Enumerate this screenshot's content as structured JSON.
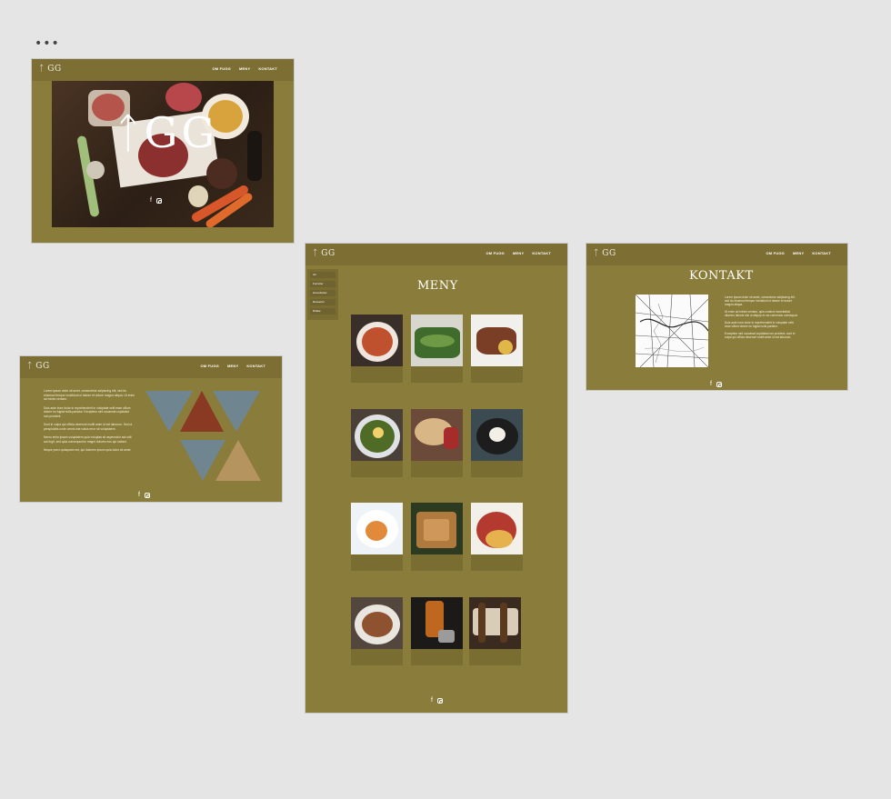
{
  "canvas": {
    "more_label": "•••"
  },
  "site": {
    "logo": "ᛏ GG"
  },
  "nav": {
    "items": [
      "OM FUGG",
      "MENY",
      "KONTAKT"
    ]
  },
  "hero": {
    "title": "ᛏGG"
  },
  "about": {
    "paragraphs": [
      "Lorem ipsum dolor sit amet, consectetur adipiscing elit, sed do eiusmod tempor incididunt ut labore et dolore magna aliqua. Ut enim ad minim veniam.",
      "Duis aute irure dolor in reprehenderit in voluptate velit esse cillum dolore eu fugiat nulla pariatur. Excepteur sint occaecat cupidatat non proident.",
      "Sunt in culpa qui officia deserunt mollit anim id est laborum. Sed ut perspiciatis unde omnis iste natus error sit voluptatem.",
      "Nemo enim ipsam voluptatem quia voluptas sit aspernatur aut odit aut fugit, sed quia consequuntur magni dolores eos qui ratione.",
      "Neque porro quisquam est, qui dolorem ipsum quia dolor sit amet."
    ]
  },
  "meny": {
    "title": "MENY",
    "sidebar": [
      "Alt",
      "Forretter",
      "Hovedretter",
      "Desserter",
      "Drikke"
    ]
  },
  "kontakt": {
    "title": "KONTAKT",
    "paragraphs": [
      "Lorem ipsum dolor sit amet, consectetur adipiscing elit, sed do eiusmod tempor incididunt ut labore et dolore magna aliqua.",
      "Ut enim ad minim veniam, quis nostrud exercitation ullamco laboris nisi ut aliquip ex ea commodo consequat.",
      "Duis aute irure dolor in reprehenderit in voluptate velit esse cillum dolore eu fugiat nulla pariatur.",
      "Excepteur sint occaecat cupidatat non proident, sunt in culpa qui officia deserunt mollit anim id est laborum."
    ]
  },
  "social": {
    "facebook": "f"
  },
  "colors": {
    "olive": "#8a7c3a",
    "nav": "#7d6f33",
    "triangle_blue": "#6f8590"
  }
}
